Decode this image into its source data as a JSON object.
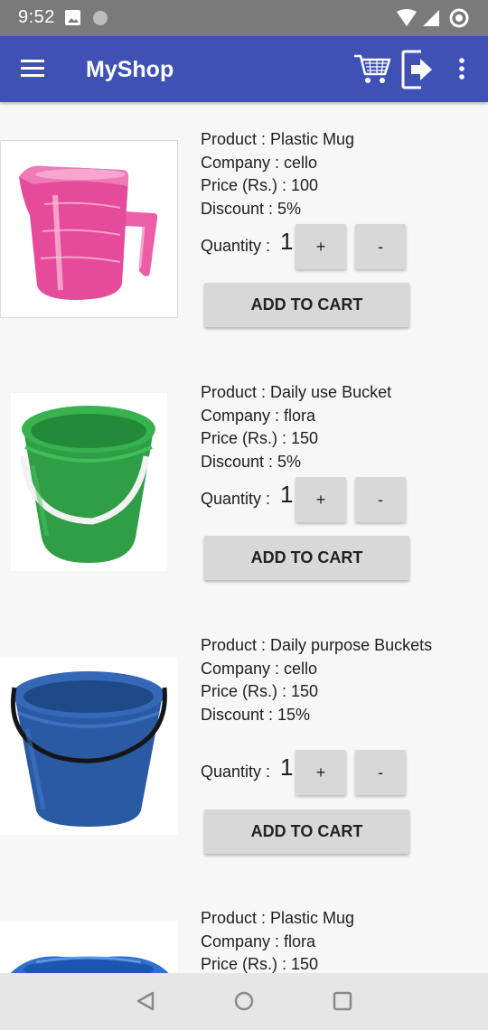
{
  "status_bar": {
    "time": "9:52",
    "icons": [
      "image-icon",
      "circle-icon",
      "wifi-icon",
      "signal-icon",
      "battery-icon"
    ]
  },
  "app_bar": {
    "title": "MyShop",
    "color": "#3f51b5",
    "icons": [
      "menu-icon",
      "cart-icon",
      "logout-icon",
      "more-vert-icon"
    ]
  },
  "products": [
    {
      "product": "Product : Plastic Mug",
      "company": "Company : cello",
      "price": "Price (Rs.) : 100",
      "discount": "Discount : 5%",
      "quantity_label": "Quantity :",
      "quantity": "1",
      "plus_label": "+",
      "minus_label": "-",
      "add_label": "ADD TO CART",
      "image": "pink-plastic-mug"
    },
    {
      "product": "Product : Daily use Bucket",
      "company": "Company : flora",
      "price": "Price (Rs.) : 150",
      "discount": "Discount : 5%",
      "quantity_label": "Quantity :",
      "quantity": "1",
      "plus_label": "+",
      "minus_label": "-",
      "add_label": "ADD TO CART",
      "image": "green-bucket"
    },
    {
      "product": "Product : Daily purpose Buckets",
      "company": "Company : cello",
      "price": "Price (Rs.) : 150",
      "discount": "Discount : 15%",
      "quantity_label": "Quantity :",
      "quantity": "1",
      "plus_label": "+",
      "minus_label": "-",
      "add_label": "ADD TO CART",
      "image": "blue-bucket"
    },
    {
      "product": "Product : Plastic Mug",
      "company": "Company : flora",
      "price": "Price (Rs.) : 150",
      "image": "blue-plastic-tub"
    }
  ],
  "nav_bar": {
    "icons": [
      "back-icon",
      "home-icon",
      "recents-icon"
    ]
  }
}
